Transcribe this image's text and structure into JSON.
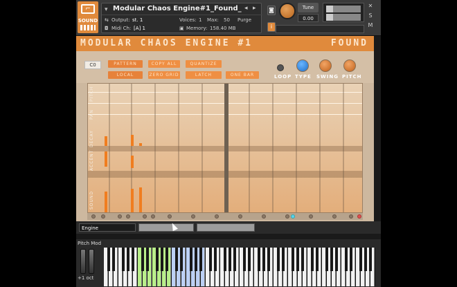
{
  "header": {
    "logo_label": "SOUND",
    "instrument_name": "Modular Chaos Engine#1_Found_",
    "output_label": "Output:",
    "output_value": "st. 1",
    "voices_label": "Voices:",
    "voices_value": "1",
    "max_label": "Max:",
    "max_value": "50",
    "purge_label": "Purge",
    "midi_label": "Midi Ch:",
    "midi_value": "[A]  1",
    "memory_label": "Memory:",
    "memory_value": "158.40 MB",
    "tune_label": "Tune",
    "tune_value": "0.00",
    "s_button": "S",
    "m_button": "M",
    "nav_prev": "◂",
    "nav_next": "▸",
    "camera_icon": "camera-icon",
    "info_icon": "info-icon"
  },
  "banner": {
    "title": "MODULAR CHAOS ENGINE #1",
    "subtitle": "FOUND"
  },
  "controls": {
    "co_value": "C0",
    "buttons": [
      "PATTERN",
      "COPY ALL",
      "QUANTIZE",
      "LOCAL",
      "ZERO GRID",
      "LATCH",
      "ONE BAR"
    ],
    "knobs": [
      {
        "label": "LOOP",
        "color": "#555555"
      },
      {
        "label": "TYPE",
        "color": "#3a8fe0"
      },
      {
        "label": "SWING",
        "color": "#e6823a"
      },
      {
        "label": "PITCH",
        "color": "#e6823a"
      }
    ]
  },
  "grid": {
    "row_labels": [
      "PITCH",
      "PAN",
      "DECAY",
      "ACCENT",
      "SOUND"
    ],
    "accent_color": "#f07d1f"
  },
  "tabs": {
    "engine": "Engine"
  },
  "keyboard": {
    "pitch_mod_label": "Pitch Mod",
    "octave_label": "+1 oct"
  },
  "colors": {
    "brand_orange": "#e08a3c",
    "panel": "#cdb89f"
  }
}
